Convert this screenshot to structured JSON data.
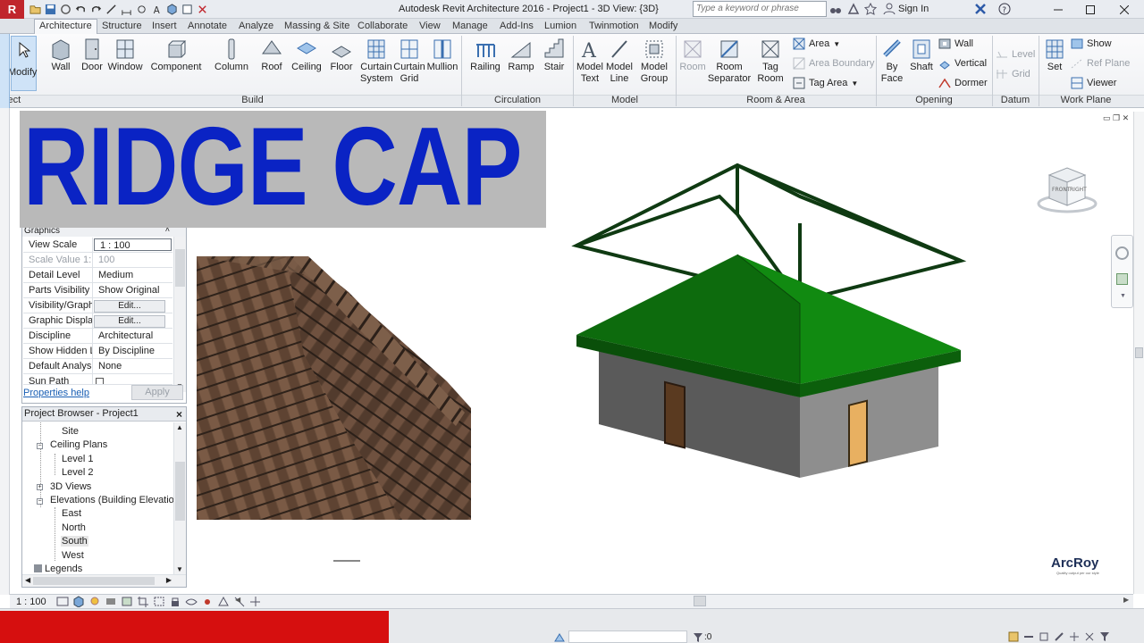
{
  "window": {
    "title": "Autodesk Revit Architecture 2016 -    Project1 - 3D View: {3D}",
    "search_placeholder": "Type a keyword or phrase",
    "sign_in": "Sign In"
  },
  "tabs": [
    "Architecture",
    "Structure",
    "Insert",
    "Annotate",
    "Analyze",
    "Massing & Site",
    "Collaborate",
    "View",
    "Manage",
    "Add-Ins",
    "Lumion",
    "Twinmotion",
    "Modify"
  ],
  "ribbon": {
    "modify": "Modify",
    "select_label": "elect",
    "build": {
      "label": "Build",
      "wall": "Wall",
      "door": "Door",
      "window": "Window",
      "component": "Component",
      "column": "Column",
      "roof": "Roof",
      "ceiling": "Ceiling",
      "floor": "Floor",
      "curtain_system": [
        "Curtain",
        "System"
      ],
      "curtain_grid": [
        "Curtain",
        "Grid"
      ],
      "mullion": "Mullion"
    },
    "circulation": {
      "label": "Circulation",
      "railing": "Railing",
      "ramp": "Ramp",
      "stair": "Stair"
    },
    "model": {
      "label": "Model",
      "model_text": [
        "Model",
        "Text"
      ],
      "model_line": [
        "Model",
        "Line"
      ],
      "model_group": [
        "Model",
        "Group"
      ]
    },
    "room_area": {
      "label": "Room & Area",
      "room": "Room",
      "room_separator": [
        "Room",
        "Separator"
      ],
      "tag_room": [
        "Tag",
        "Room"
      ],
      "area": "Area",
      "area_boundary": "Area  Boundary",
      "tag_area": "Tag  Area"
    },
    "opening": {
      "label": "Opening",
      "by_face": [
        "By",
        "Face"
      ],
      "shaft": "Shaft",
      "wall": "Wall",
      "vertical": "Vertical",
      "dormer": "Dormer"
    },
    "datum": {
      "label": "Datum",
      "level": "Level",
      "grid": "Grid"
    },
    "work_plane": {
      "label": "Work Plane",
      "set": "Set",
      "show": "Show",
      "ref_plane": "Ref  Plane",
      "viewer": "Viewer"
    }
  },
  "banner": {
    "text": "RIDGE CAP"
  },
  "properties": {
    "header": "Graphics",
    "rows": [
      {
        "label": "View Scale",
        "value": "1 : 100"
      },
      {
        "label": "Scale Value    1:",
        "value": "100"
      },
      {
        "label": "Detail Level",
        "value": "Medium"
      },
      {
        "label": "Parts Visibility",
        "value": "Show Original"
      },
      {
        "label": "Visibility/Graph...",
        "value": "Edit..."
      },
      {
        "label": "Graphic Display...",
        "value": "Edit..."
      },
      {
        "label": "Discipline",
        "value": "Architectural"
      },
      {
        "label": "Show Hidden Li...",
        "value": "By Discipline"
      },
      {
        "label": "Default Analysi...",
        "value": "None"
      },
      {
        "label": "Sun Path",
        "value": ""
      }
    ],
    "help_link": "Properties help",
    "apply": "Apply"
  },
  "project_browser": {
    "title": "Project Browser - Project1",
    "items": [
      "Site",
      "Ceiling Plans",
      "Level 1",
      "Level 2",
      "3D Views",
      "Elevations (Building Elevation",
      "East",
      "North",
      "South",
      "West",
      "Legends"
    ]
  },
  "viewcube": {
    "front": "FRONT",
    "right": "RIGHT"
  },
  "brand": {
    "name": "ArcRoy",
    "tagline": "Quality output per our style"
  },
  "viewbar": {
    "scale": "1 : 100"
  },
  "statusbar": {
    "selection_count": ":0"
  },
  "colors": {
    "banner_text": "#0a23c4",
    "banner_bg": "#b9b9b9",
    "roof": "#0e7a0e",
    "wall": "#6b6b6b",
    "door": "#e8b061",
    "status_red": "#d60f0f"
  }
}
